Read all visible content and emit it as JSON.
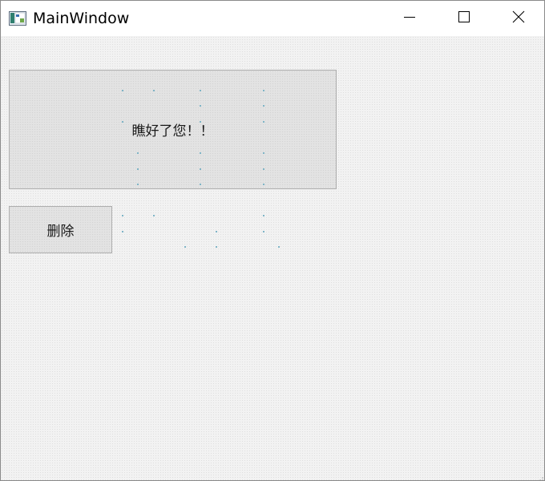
{
  "window": {
    "title": "MainWindow",
    "app_icon": "qt-window-icon",
    "controls": {
      "minimize_icon": "minimize-icon",
      "maximize_icon": "maximize-icon",
      "close_icon": "close-icon"
    }
  },
  "main": {
    "hello_button_label": "瞧好了您！！",
    "delete_button_label": "删除"
  },
  "colors": {
    "titlebar": "#ffffff",
    "background": "#f0f0f0",
    "button_face": "#e3e3e3",
    "button_border": "#adadad",
    "artifact_dots": "#7fb4c6"
  }
}
